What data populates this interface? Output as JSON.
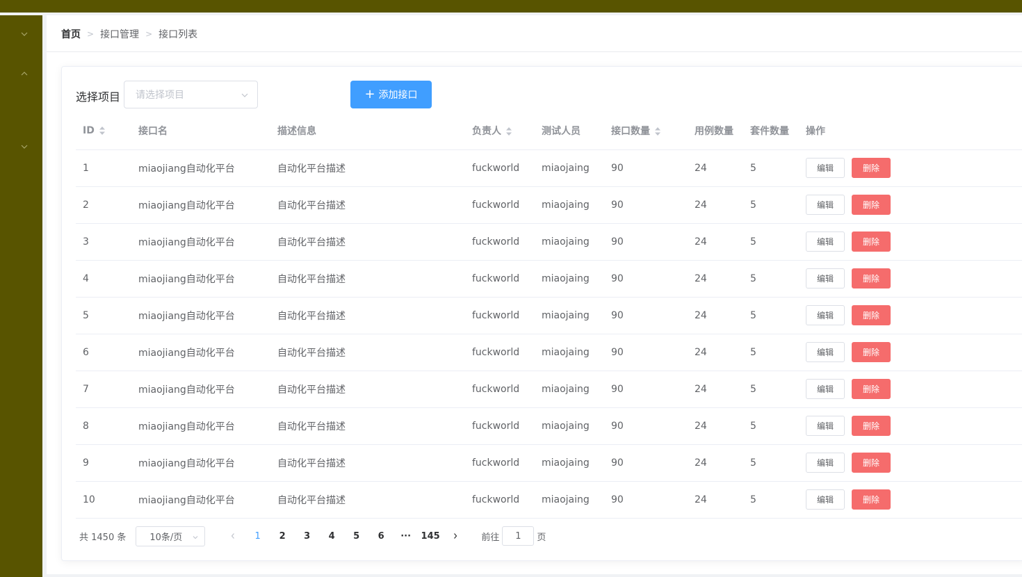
{
  "colors": {
    "sidebar": "#585400",
    "primary": "#409eff",
    "danger": "#f56c6c"
  },
  "sidebar": {
    "arrows": [
      "chevron-down-icon",
      "chevron-up-icon",
      "chevron-down-icon"
    ]
  },
  "breadcrumb": {
    "home": "首页",
    "section": "接口管理",
    "current": "接口列表"
  },
  "filter": {
    "label": "选择项目",
    "placeholder": "请选择项目"
  },
  "add_button": {
    "icon": "plus-icon",
    "label": "添加接口"
  },
  "table": {
    "headers": [
      "ID",
      "接口名",
      "描述信息",
      "负责人",
      "测试人员",
      "接口数量",
      "用例数量",
      "套件数量",
      "操作"
    ],
    "sortable": [
      "ID",
      "负责人",
      "接口数量"
    ],
    "edit_label": "编辑",
    "delete_label": "删除",
    "rows": [
      [
        "1",
        "miaojiang自动化平台",
        "自动化平台描述",
        "fuckworld",
        "miaojaing",
        "90",
        "24",
        "5"
      ],
      [
        "2",
        "miaojiang自动化平台",
        "自动化平台描述",
        "fuckworld",
        "miaojaing",
        "90",
        "24",
        "5"
      ],
      [
        "3",
        "miaojiang自动化平台",
        "自动化平台描述",
        "fuckworld",
        "miaojaing",
        "90",
        "24",
        "5"
      ],
      [
        "4",
        "miaojiang自动化平台",
        "自动化平台描述",
        "fuckworld",
        "miaojaing",
        "90",
        "24",
        "5"
      ],
      [
        "5",
        "miaojiang自动化平台",
        "自动化平台描述",
        "fuckworld",
        "miaojaing",
        "90",
        "24",
        "5"
      ],
      [
        "6",
        "miaojiang自动化平台",
        "自动化平台描述",
        "fuckworld",
        "miaojaing",
        "90",
        "24",
        "5"
      ],
      [
        "7",
        "miaojiang自动化平台",
        "自动化平台描述",
        "fuckworld",
        "miaojaing",
        "90",
        "24",
        "5"
      ],
      [
        "8",
        "miaojiang自动化平台",
        "自动化平台描述",
        "fuckworld",
        "miaojaing",
        "90",
        "24",
        "5"
      ],
      [
        "9",
        "miaojiang自动化平台",
        "自动化平台描述",
        "fuckworld",
        "miaojaing",
        "90",
        "24",
        "5"
      ],
      [
        "10",
        "miaojiang自动化平台",
        "自动化平台描述",
        "fuckworld",
        "miaojaing",
        "90",
        "24",
        "5"
      ]
    ]
  },
  "pagination": {
    "total": "共 1450 条",
    "page_size": "10条/页",
    "pages": [
      "1",
      "2",
      "3",
      "4",
      "5",
      "6",
      "···",
      "145"
    ],
    "current_page": "1",
    "goto_prefix": "前往",
    "goto_value": "1",
    "goto_suffix": "页"
  }
}
